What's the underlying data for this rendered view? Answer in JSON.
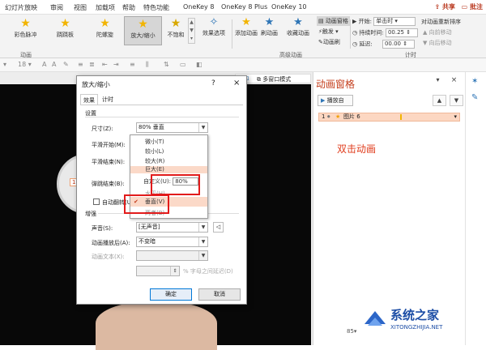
{
  "tabs": [
    "幻灯片放映",
    "审阅",
    "视图",
    "加载项",
    "帮助",
    "特色功能",
    "OneKey 8",
    "OneKey 8 Plus",
    "OneKey 10"
  ],
  "share": "共享",
  "comment": "批注",
  "animations": [
    "彩色脉冲",
    "跷跷板",
    "陀螺旋",
    "放大/缩小",
    "不饱和"
  ],
  "ribbon": {
    "effect_options": "效果选项",
    "add_animation": "添加动画",
    "animation_painter": "刷动画",
    "collect_animation": "收藏动画",
    "animation_pane": "动画窗格",
    "trigger": "触发",
    "anim_brush": "动画刷",
    "start_label": "开始:",
    "start_value": "单击时",
    "duration_label": "持续时间:",
    "duration_value": "00.25",
    "delay_label": "延迟:",
    "delay_value": "00.00",
    "reorder": "对动画重新排序",
    "move_earlier": "向前移动",
    "move_later": "向后移动",
    "group_animation": "动画",
    "group_advanced": "高级动画",
    "group_timing": "计时"
  },
  "toolbar": {
    "font_size": "18",
    "multi_window": "多窗口模式"
  },
  "dialog": {
    "title": "放大/缩小",
    "help": "?",
    "close": "×",
    "tab_effect": "效果",
    "tab_timing": "计时",
    "settings": "设置",
    "size_label": "尺寸(Z):",
    "size_value": "80% 垂直",
    "smooth_start": "平滑开始(M):",
    "smooth_end": "平滑结束(N):",
    "bounce_end": "弹跳结束(B):",
    "auto_reverse": "自动翻转(U)",
    "enhance": "增强",
    "sound_label": "声音(S):",
    "sound_value": "[无声音]",
    "after_anim_label": "动画播放后(A):",
    "after_anim_value": "不变暗",
    "anim_text_label": "动画文本(X):",
    "letter_delay": "% 字母之间延迟(D)",
    "ok": "确定",
    "cancel": "取消"
  },
  "menu": {
    "items": [
      "微小(T)",
      "较小(L)",
      "较大(R)",
      "巨大(E)"
    ],
    "custom_label": "自定义(U):",
    "custom_value": "80%",
    "partial": "水平(H)",
    "vertical": "垂直(V)",
    "both": "两者(B)"
  },
  "pane": {
    "title": "动画窗格",
    "play_from": "播放自",
    "item_number": "1",
    "item_name": "图片 6",
    "annotation": "双击动画"
  },
  "slide": {
    "placeholder": "1"
  },
  "watermark": {
    "name": "系统之家",
    "url": "XITONGZHIJIA.NET"
  },
  "status": {
    "zoom": "85"
  },
  "colors": {
    "accent": "#c43e1c",
    "highlight": "#e21b1b"
  }
}
